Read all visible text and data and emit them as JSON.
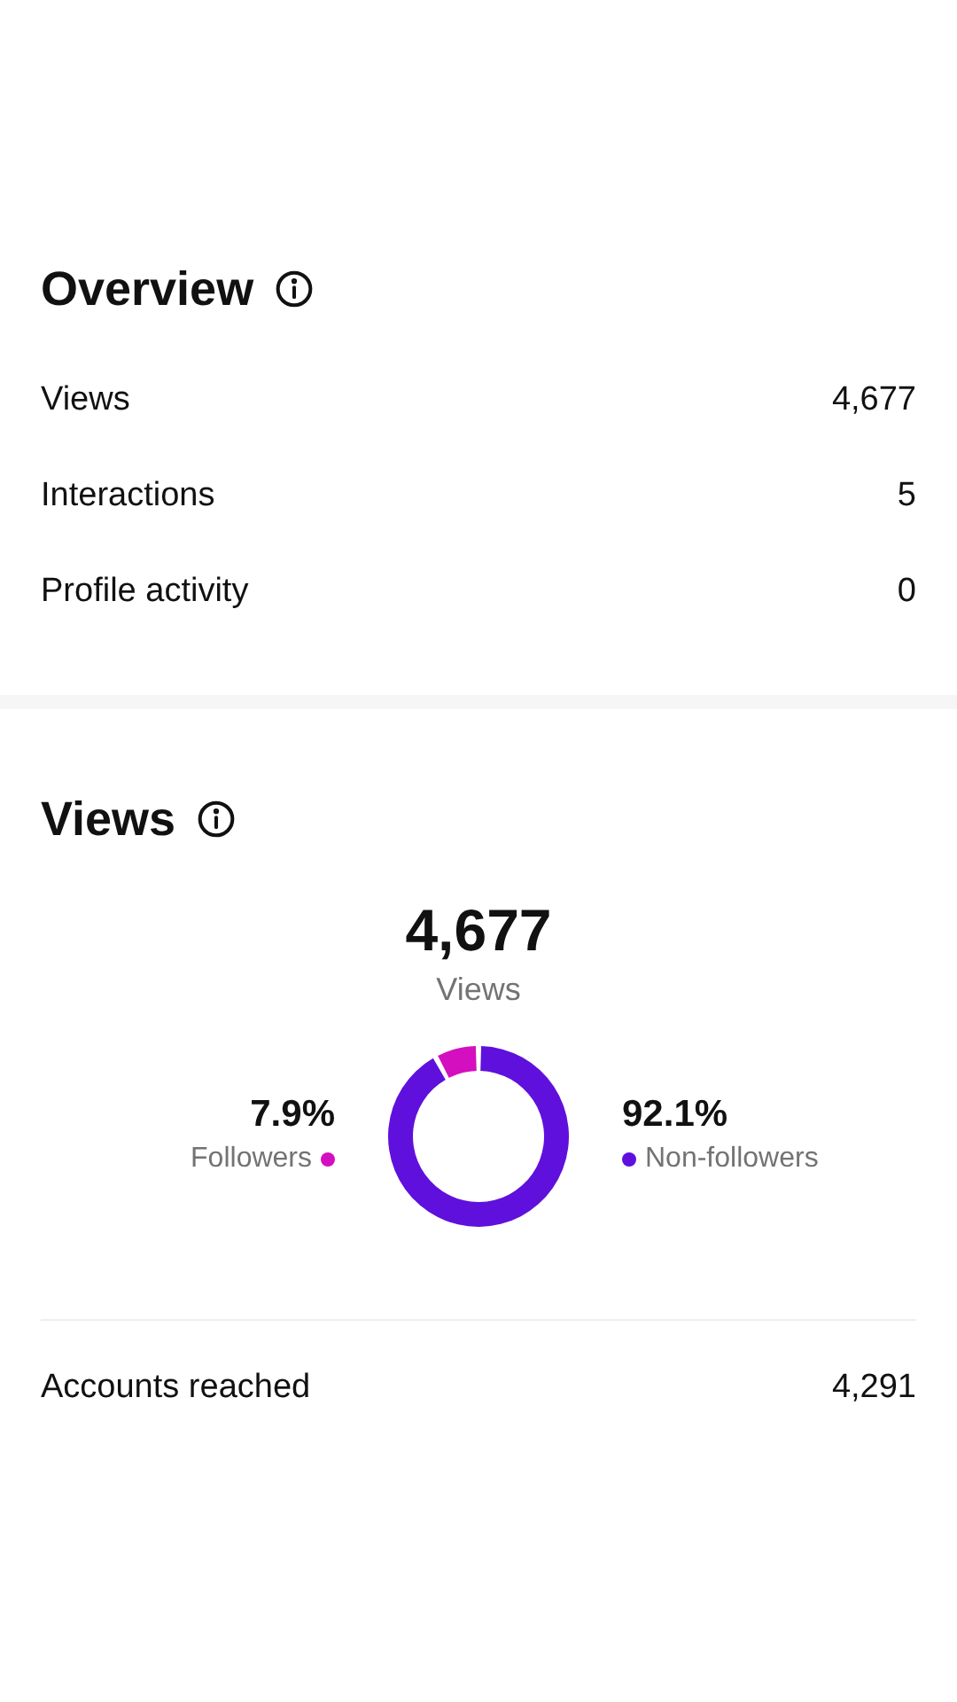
{
  "overview": {
    "title": "Overview",
    "rows": [
      {
        "label": "Views",
        "value": "4,677"
      },
      {
        "label": "Interactions",
        "value": "5"
      },
      {
        "label": "Profile activity",
        "value": "0"
      }
    ]
  },
  "views": {
    "title": "Views",
    "total": "4,677",
    "total_label": "Views",
    "legend": [
      {
        "value": "7.9%",
        "color": "#d40fbf"
      },
      {
        "value": "92.1%",
        "color": "#5f10dc"
      }
    ],
    "chart_data": {
      "type": "donut",
      "categories": [
        "Followers",
        "Non-followers"
      ],
      "values": [
        7.9,
        92.1
      ]
    },
    "rows": [
      {
        "label": "Accounts reached",
        "value": "4,291"
      }
    ]
  }
}
